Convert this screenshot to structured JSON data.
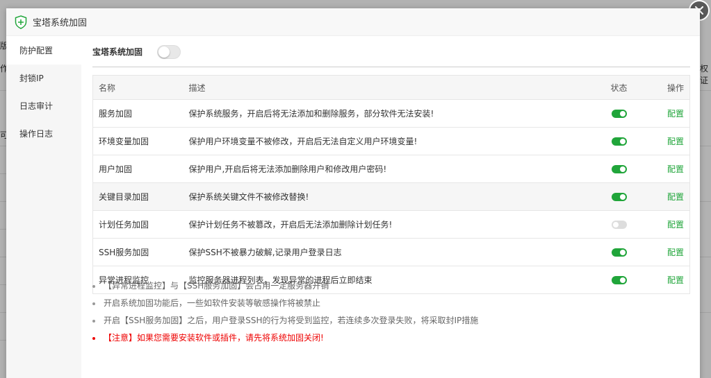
{
  "background": {
    "fragments": [
      "版",
      "作业",
      "权证",
      "可"
    ]
  },
  "modal": {
    "title": "宝塔系统加固",
    "close_icon": "close-icon"
  },
  "sidebar": {
    "items": [
      {
        "label": "防护配置",
        "active": true
      },
      {
        "label": "封锁IP"
      },
      {
        "label": "日志审计"
      },
      {
        "label": "操作日志"
      }
    ]
  },
  "main": {
    "switch_label": "宝塔系统加固",
    "switch_on": false,
    "table": {
      "headers": {
        "name": "名称",
        "desc": "描述",
        "state": "状态",
        "op": "操作"
      },
      "rows": [
        {
          "name": "服务加固",
          "desc": "保护系统服务，开启后将无法添加和删除服务，部分软件无法安装!",
          "state": "on",
          "op": "配置"
        },
        {
          "name": "环境变量加固",
          "desc": "保护用户环境变量不被修改，开启后无法自定义用户环境变量!",
          "state": "on",
          "op": "配置"
        },
        {
          "name": "用户加固",
          "desc": "保护用户,开启后将无法添加删除用户和修改用户密码!",
          "state": "on",
          "op": "配置"
        },
        {
          "name": "关键目录加固",
          "desc": "保护系统关键文件不被修改替换!",
          "state": "on",
          "op": "配置"
        },
        {
          "name": "计划任务加固",
          "desc": "保护计划任务不被篡改，开启后无法添加删除计划任务!",
          "state": "off",
          "op": "配置"
        },
        {
          "name": "SSH服务加固",
          "desc": "保护SSH不被暴力破解,记录用户登录日志",
          "state": "on",
          "op": "配置"
        },
        {
          "name": "异常进程监控",
          "desc": "监控服务器进程列表，发现异常的进程后立即结束",
          "state": "on",
          "op": "配置"
        }
      ]
    },
    "notes": [
      "【异常进程监控】与【SSH服务加固】会占用一定服务器开销",
      "开启系统加固功能后，一些如软件安装等敏感操作将被禁止",
      "开启【SSH服务加固】之后，用户登录SSH的行为将受到监控，若连续多次登录失败，将采取封IP措施",
      "【注意】如果您需要安装软件或插件，请先将系统加固关闭!"
    ]
  },
  "colors": {
    "accent": "#20a53a",
    "warning": "#ee0000",
    "toggle_off": "#dddddd"
  }
}
